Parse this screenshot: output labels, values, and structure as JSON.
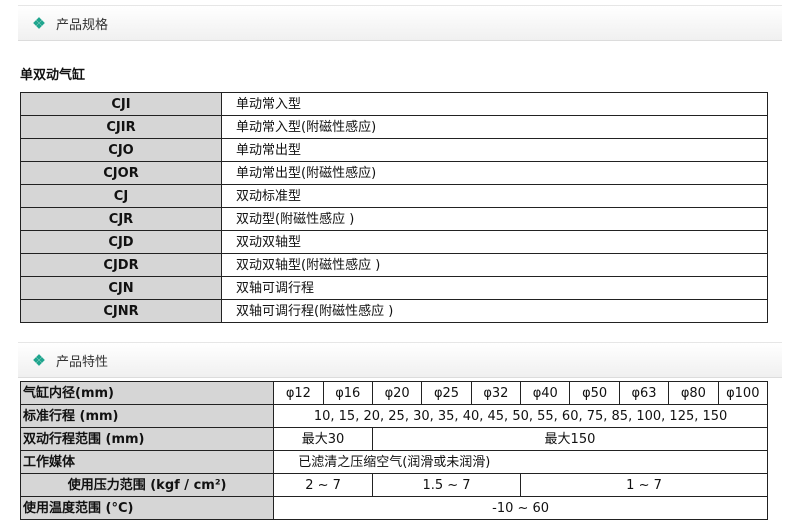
{
  "section1": {
    "title": "产品规格"
  },
  "subtitle": "单双动气缸",
  "models": [
    {
      "code": "CJI",
      "desc": "单动常入型"
    },
    {
      "code": "CJIR",
      "desc": "单动常入型(附磁性感应)"
    },
    {
      "code": "CJO",
      "desc": "单动常出型"
    },
    {
      "code": "CJOR",
      "desc": "单动常出型(附磁性感应)"
    },
    {
      "code": "CJ",
      "desc": "双动标准型"
    },
    {
      "code": "CJR",
      "desc": "双动型(附磁性感应 )"
    },
    {
      "code": "CJD",
      "desc": "双动双轴型"
    },
    {
      "code": "CJDR",
      "desc": "双动双轴型(附磁性感应 )"
    },
    {
      "code": "CJN",
      "desc": "双轴可调行程"
    },
    {
      "code": "CJNR",
      "desc": "双轴可调行程(附磁性感应 )"
    }
  ],
  "section2": {
    "title": "产品特性"
  },
  "specs": {
    "bore_label": "气缸内径(mm)",
    "bores": [
      "φ12",
      "φ16",
      "φ20",
      "φ25",
      "φ32",
      "φ40",
      "φ50",
      "φ63",
      "φ80",
      "φ100"
    ],
    "stroke_label": "标准行程 (mm)",
    "stroke_value": "10, 15, 20, 25, 30, 35, 40, 45, 50, 55, 60, 75, 85, 100, 125, 150",
    "range_label": "双动行程范围 (mm)",
    "range_a": "最大30",
    "range_b": "最大150",
    "medium_label": "工作媒体",
    "medium_value": "已滤清之压缩空气(润滑或未润滑)",
    "pressure_label": "使用压力范围 (kgf / cm²)",
    "pressure_a": "2 ~ 7",
    "pressure_b": "1.5 ~ 7",
    "pressure_c": "1 ~ 7",
    "temp_label": "使用温度范围 (°C)",
    "temp_value": "-10 ~ 60"
  },
  "colors": {
    "accent": "#1fa58e",
    "label_bg": "#d6d6d6"
  }
}
